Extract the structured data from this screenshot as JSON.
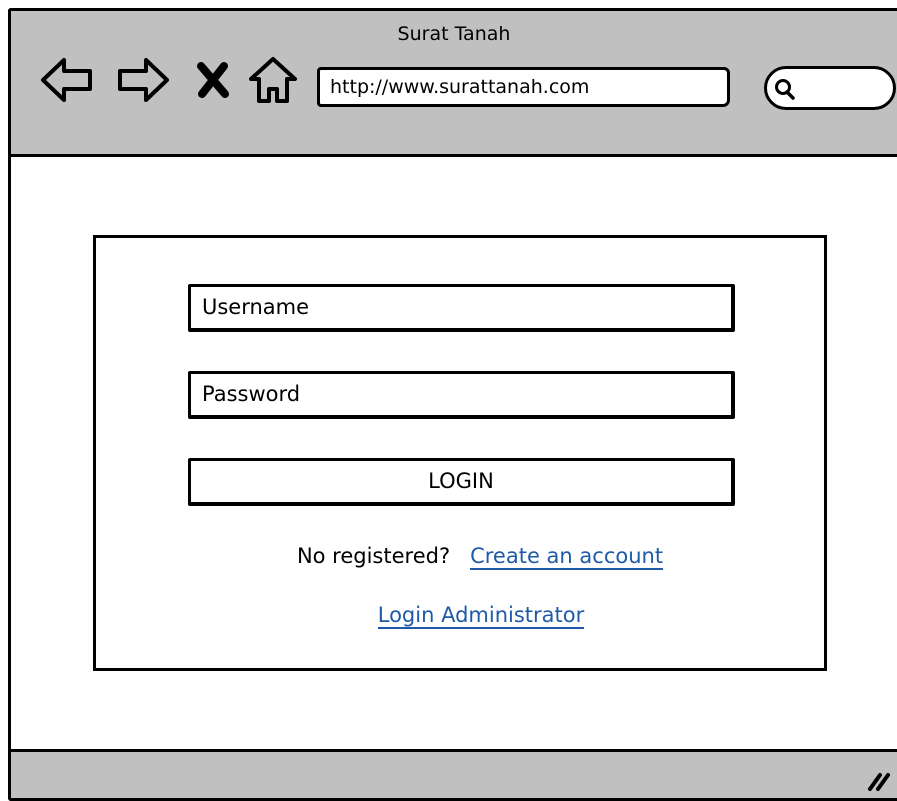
{
  "window": {
    "title": "Surat Tanah"
  },
  "toolbar": {
    "back_icon": "left-arrow-icon",
    "forward_icon": "right-arrow-icon",
    "stop_icon": "close-x-icon",
    "home_icon": "home-icon",
    "url": "http://www.surattanah.com",
    "search_value": "",
    "search_icon": "search-icon"
  },
  "login_form": {
    "username_placeholder": "Username",
    "password_placeholder": "Password",
    "login_label": "LOGIN",
    "register_prompt": "No registered?",
    "create_account_link": "Create an account",
    "admin_login_link": "Login Administrator"
  },
  "statusbar": {
    "grip_icon": "resize-grip-icon"
  },
  "colors": {
    "chrome_background": "#c0c0c0",
    "link": "#1f5aa8",
    "border": "#000000"
  }
}
